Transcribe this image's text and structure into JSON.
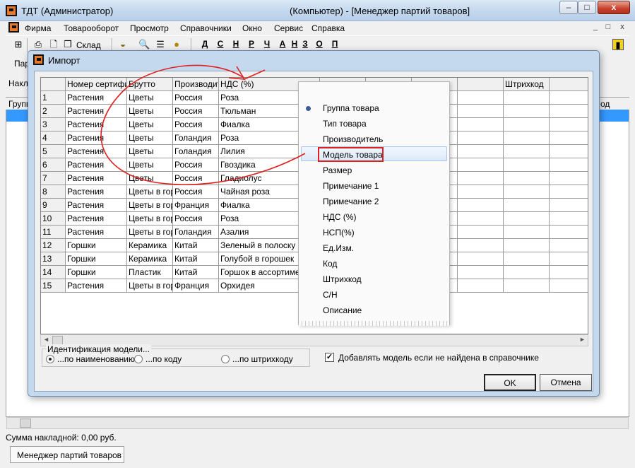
{
  "window": {
    "title_left": "ТДТ  (Администратор)",
    "title_right": "(Компьютер) - [Менеджер партий товаров]",
    "minimize": "–",
    "restore": "□",
    "close": "x"
  },
  "menu": [
    "Фирма",
    "Товарооборот",
    "Просмотр",
    "Справочники",
    "Окно",
    "Сервис",
    "Справка"
  ],
  "mdi_controls": [
    "_",
    "□",
    "x"
  ],
  "toolbar": {
    "sklad_label": "Склад",
    "letters": [
      "Д",
      "С",
      "Н",
      "Р",
      "Ч",
      "А",
      "Н",
      "З",
      "О",
      "П"
    ]
  },
  "background": {
    "label_par": "Пар",
    "label_nakl": "Накл",
    "col_group": "Групп",
    "col_barcode": "од",
    "status_sum_label": "Сумма накладной:",
    "status_sum_value": "0,00 руб.",
    "task_tab": "Менеджер партий товаров"
  },
  "dialog": {
    "title": "Импорт",
    "columns": [
      "Номер сертифи",
      "Брутто",
      "Производит",
      "НДС (%)",
      "",
      "",
      "",
      "",
      "Штрихкод",
      ""
    ],
    "rows": [
      [
        "1",
        "Растения",
        "Цветы",
        "Россия",
        "Роза"
      ],
      [
        "2",
        "Растения",
        "Цветы",
        "Россия",
        "Тюльман"
      ],
      [
        "3",
        "Растения",
        "Цветы",
        "Россия",
        "Фиалка"
      ],
      [
        "4",
        "Растения",
        "Цветы",
        "Голандия",
        "Роза"
      ],
      [
        "5",
        "Растения",
        "Цветы",
        "Голандия",
        "Лилия"
      ],
      [
        "6",
        "Растения",
        "Цветы",
        "Россия",
        "Гвоздика"
      ],
      [
        "7",
        "Растения",
        "Цветы",
        "Россия",
        "Гладиолус"
      ],
      [
        "8",
        "Растения",
        "Цветы в горшк",
        "Россия",
        "Чайная роза"
      ],
      [
        "9",
        "Растения",
        "Цветы в горшк",
        "Франция",
        "Фиалка"
      ],
      [
        "10",
        "Растения",
        "Цветы в горшк",
        "Россия",
        "Роза"
      ],
      [
        "11",
        "Растения",
        "Цветы в горшк",
        "Голандия",
        "Азалия"
      ],
      [
        "12",
        "Горшки",
        "Керамика",
        "Китай",
        "Зеленый в полоску"
      ],
      [
        "13",
        "Горшки",
        "Керамика",
        "Китай",
        "Голубой в горошек"
      ],
      [
        "14",
        "Горшки",
        "Пластик",
        "Китай",
        "Горшок в ассортименте"
      ],
      [
        "15",
        "Растения",
        "Цветы в горшк",
        "Франция",
        "Орхидея"
      ]
    ],
    "ident_group_label": "Идентификация модели...",
    "radio_name": "...по наименованию",
    "radio_code": "...по коду",
    "radio_barcode": "...по штрихкоду",
    "add_model_checkbox": "Добавлять модель если не найдена в справочнике",
    "add_model_checked": true,
    "ok": "OK",
    "cancel": "Отмена"
  },
  "dropdown": {
    "items": [
      "Группа товара",
      "Тип товара",
      "Производитель",
      "Модель товара",
      "Размер",
      "Примечание 1",
      "Примечание 2",
      "НДС (%)",
      "НСП(%)",
      "Ед.Изм.",
      "Код",
      "Штрихкод",
      "С/Н",
      "Описание"
    ],
    "selected": "Модель товара"
  },
  "colors": {
    "selection_blue": "#3399ff",
    "annotation_red": "#e02020"
  }
}
